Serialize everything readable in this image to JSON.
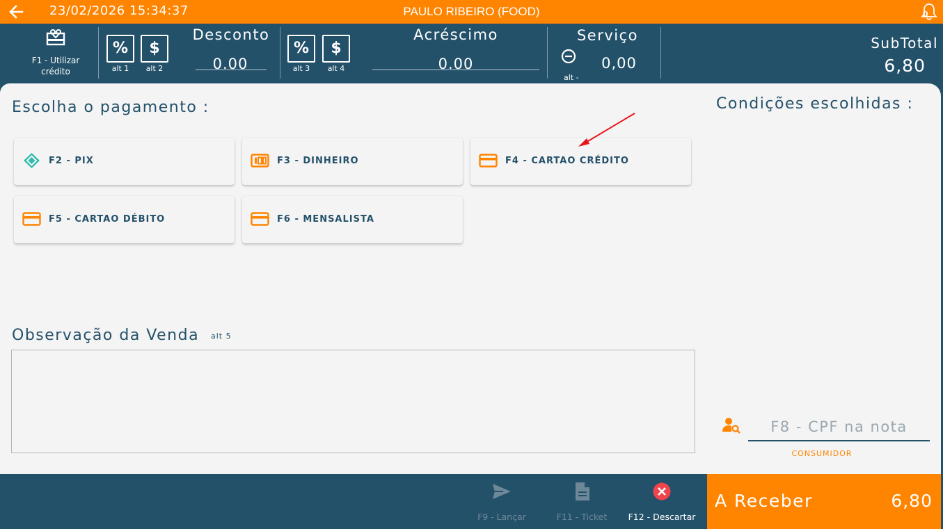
{
  "topbar": {
    "datetime": "23/02/2026 15:34:37",
    "title": "PAULO RIBEIRO (FOOD)",
    "notification_count": "0",
    "brand_color": "#ff8400"
  },
  "header": {
    "credit_label": "F1 -  Utilizar crédito",
    "discount": {
      "title": "Desconto",
      "value": "0.00",
      "percent_shortcut": "alt 1",
      "amount_shortcut": "alt 2"
    },
    "surcharge": {
      "title": "Acréscimo",
      "value": "0.00",
      "percent_shortcut": "alt 3",
      "amount_shortcut": "alt 4"
    },
    "service": {
      "title": "Serviço",
      "value": "0,00",
      "shortcut": "alt -"
    },
    "subtotal": {
      "label": "SubTotal",
      "value": "6,80"
    },
    "percent_symbol": "%",
    "dollar_symbol": "$"
  },
  "payment": {
    "title": "Escolha o pagamento :",
    "methods": [
      {
        "label": "F2 - PIX",
        "icon": "pix-icon"
      },
      {
        "label": "F3 - DINHEIRO",
        "icon": "money-icon"
      },
      {
        "label": "F4 - CARTAO CRÉDITO",
        "icon": "credit-card-icon"
      },
      {
        "label": "F5 - CARTAO DÉBITO",
        "icon": "credit-card-icon"
      },
      {
        "label": "F6 - MENSALISTA",
        "icon": "credit-card-icon"
      }
    ]
  },
  "conditions": {
    "title": "Condições escolhidas :"
  },
  "observation": {
    "title": "Observação da Venda",
    "shortcut": "alt 5",
    "value": ""
  },
  "consumer": {
    "cpf_placeholder": "F8 - CPF na nota",
    "label": "CONSUMIDOR"
  },
  "footer": {
    "launch_label": "F9 - Lançar",
    "ticket_label": "F11 - Ticket",
    "discard_label": "F12 - Descartar",
    "receive_label": "A Receber",
    "receive_value": "6,80"
  }
}
